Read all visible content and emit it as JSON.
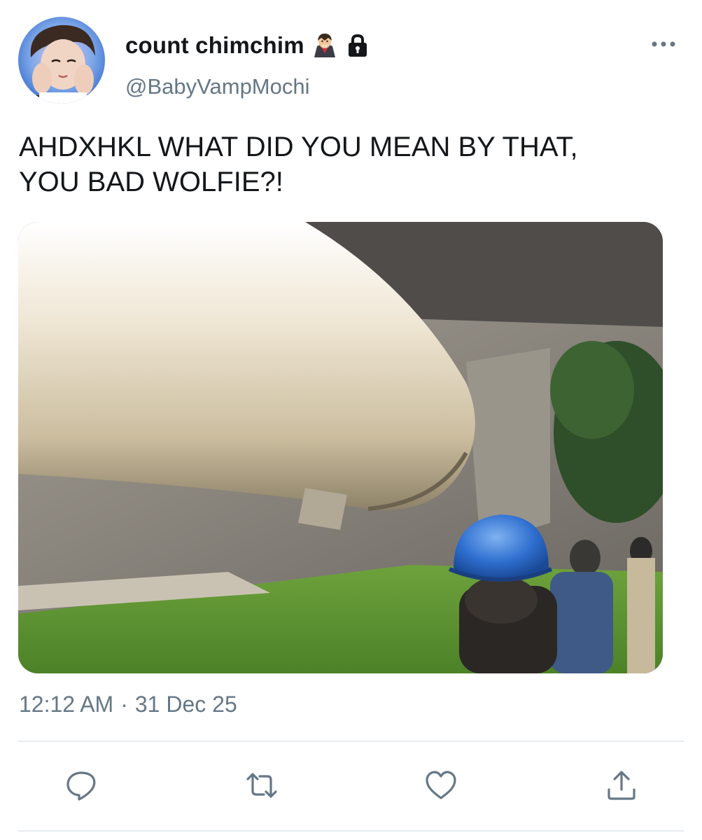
{
  "user": {
    "display_name": "count chimchim",
    "handle": "@BabyVampMochi",
    "badges": [
      "vampire-emoji",
      "lock-icon"
    ],
    "protected": true
  },
  "tweet": {
    "text": "AHDXHKL WHAT DID YOU MEAN BY THAT,\nYOU BAD WOLFIE?!",
    "time": "12:12 AM",
    "separator": "·",
    "date": "31 Dec 25",
    "media": {
      "type": "gif",
      "subject": "giant inflatable tube over person in blue hard hat"
    }
  },
  "actions": [
    {
      "name": "reply",
      "icon": "reply-icon"
    },
    {
      "name": "retweet",
      "icon": "retweet-icon"
    },
    {
      "name": "like",
      "icon": "heart-icon"
    },
    {
      "name": "share",
      "icon": "share-icon"
    }
  ],
  "colors": {
    "primary_text": "#14171a",
    "secondary_text": "#657786",
    "icon": "#657786",
    "divider": "#e6ecf0"
  }
}
